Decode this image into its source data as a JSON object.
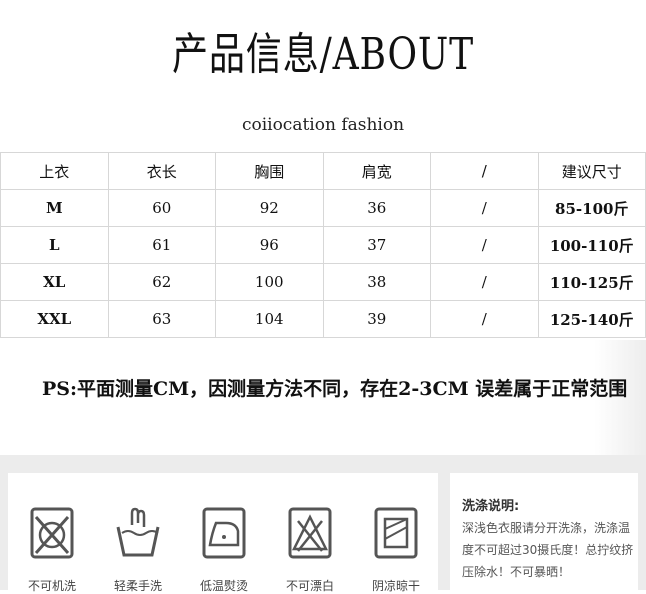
{
  "header": {
    "title": "产品信息/ABOUT",
    "subtitle": "coiiocation fashion"
  },
  "size_table": {
    "columns": [
      "上衣",
      "衣长",
      "胸围",
      "肩宽",
      "/",
      "建议尺寸"
    ],
    "rows": [
      [
        "M",
        "60",
        "92",
        "36",
        "/",
        "85-100斤"
      ],
      [
        "L",
        "61",
        "96",
        "37",
        "/",
        "100-110斤"
      ],
      [
        "XL",
        "62",
        "100",
        "38",
        "/",
        "110-125斤"
      ],
      [
        "XXL",
        "63",
        "104",
        "39",
        "/",
        "125-140斤"
      ]
    ]
  },
  "note": "PS:平面测量CM，因测量方法不同，存在2-3CM 误差属于正常范围",
  "care": {
    "icons": [
      {
        "icon": "no-machine-wash-icon",
        "label": "不可机洗"
      },
      {
        "icon": "hand-wash-icon",
        "label": "轻柔手洗"
      },
      {
        "icon": "low-iron-icon",
        "label": "低温熨烫"
      },
      {
        "icon": "no-bleach-icon",
        "label": "不可漂白"
      },
      {
        "icon": "shade-dry-icon",
        "label": "阴凉晾干"
      }
    ],
    "wash_title": "洗涤说明:",
    "wash_text": "深浅色衣服请分开洗涤，洗涤温度不可超过30摄氏度！总拧纹挤压除水！不可暴晒！"
  },
  "colors": {
    "border": "#d7d7d7",
    "care_bg": "#ececec",
    "icon_stroke": "#555555"
  }
}
